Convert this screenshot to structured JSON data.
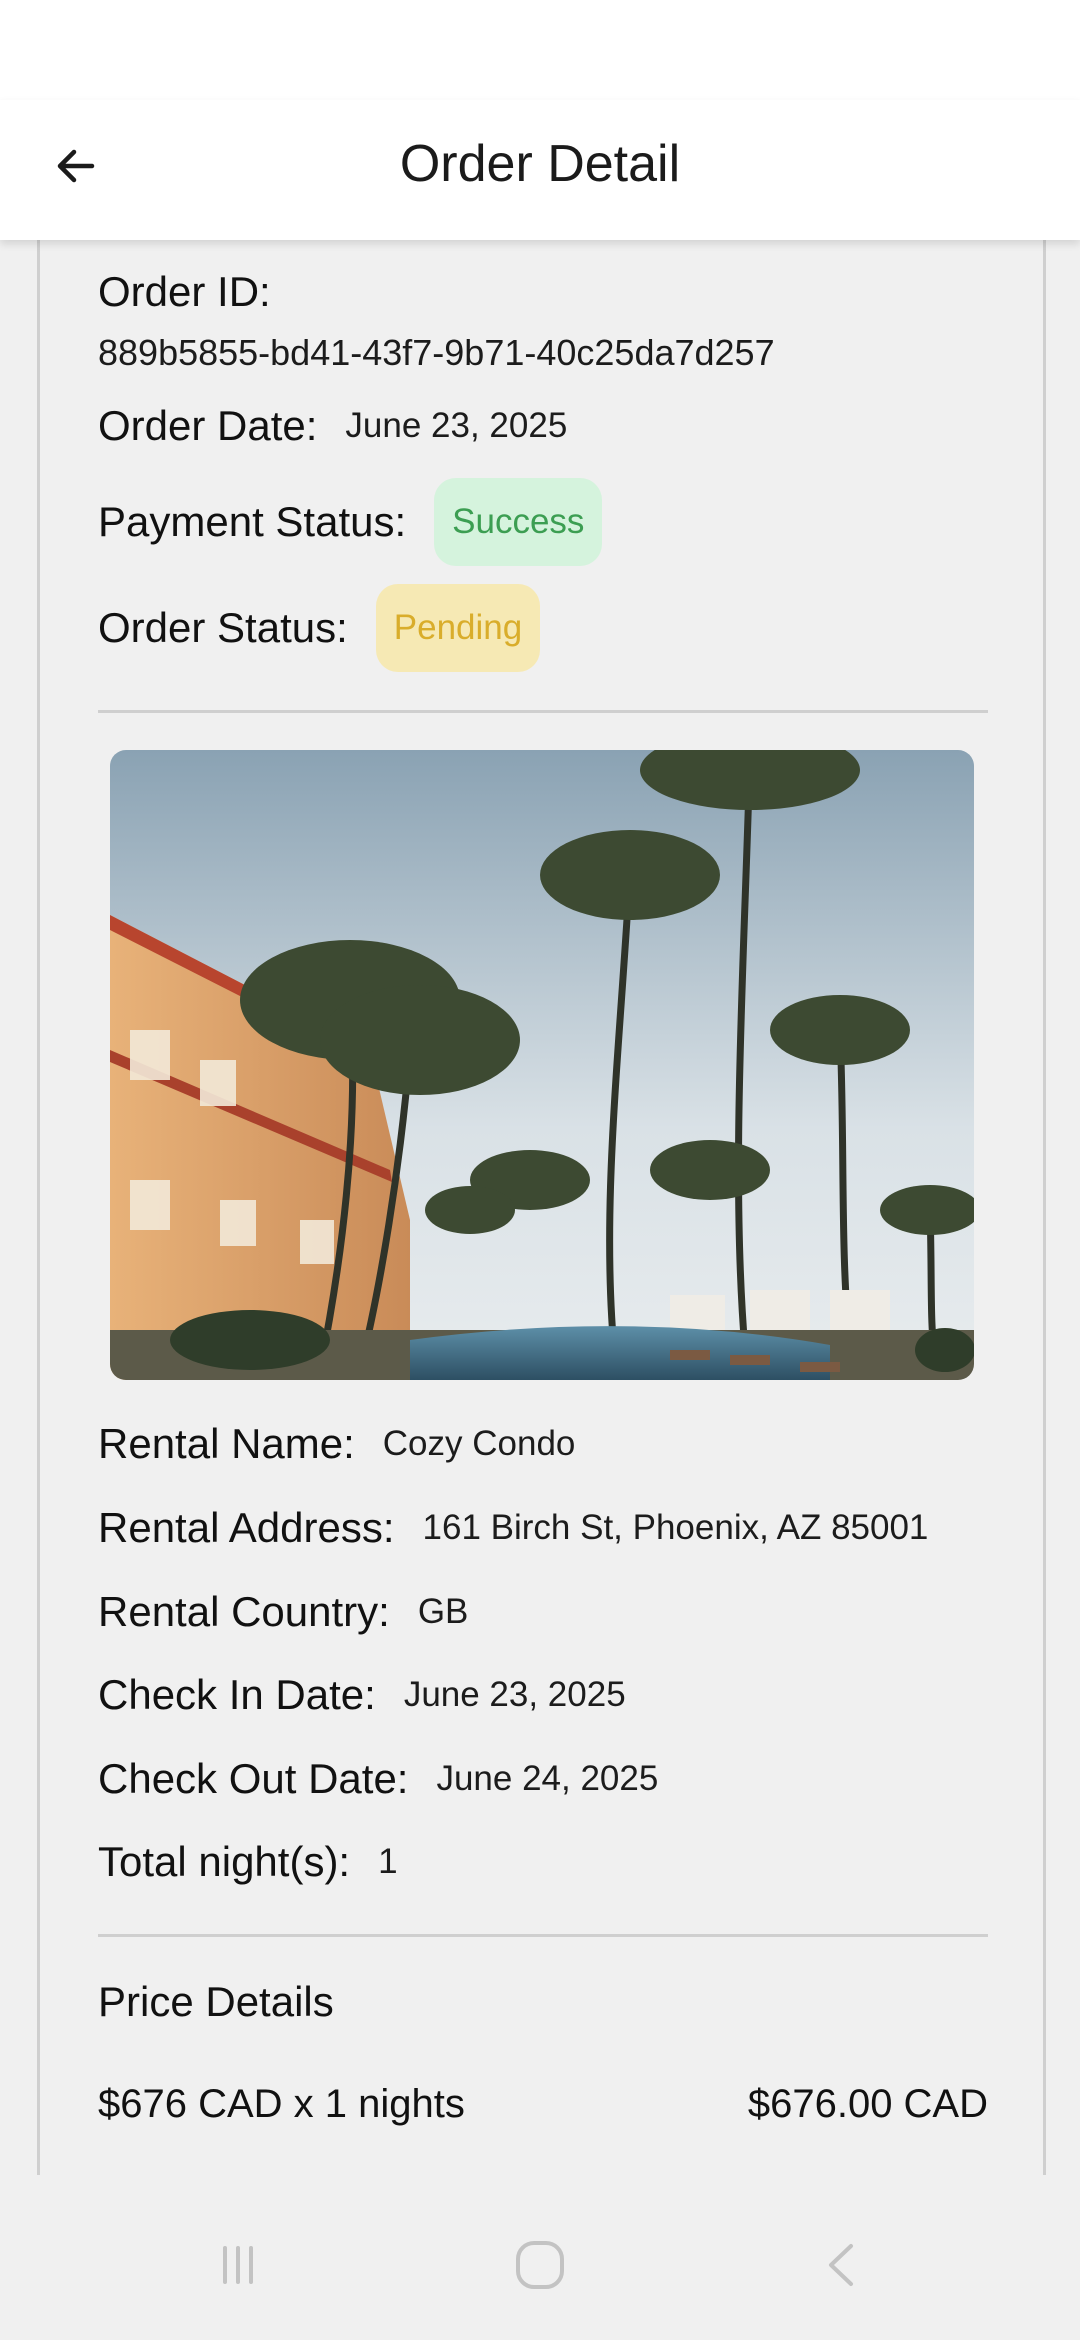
{
  "header": {
    "title": "Order Detail"
  },
  "order": {
    "id_label": "Order ID:",
    "id_value": "889b5855-bd41-43f7-9b71-40c25da7d257",
    "date_label": "Order Date:",
    "date_value": "June 23, 2025",
    "payment_status_label": "Payment Status:",
    "payment_status_value": "Success",
    "order_status_label": "Order Status:",
    "order_status_value": "Pending"
  },
  "rental": {
    "name_label": "Rental Name:",
    "name_value": "Cozy Condo",
    "address_label": "Rental Address:",
    "address_value": "161 Birch St, Phoenix, AZ 85001",
    "country_label": "Rental Country:",
    "country_value": "GB",
    "checkin_label": "Check In Date:",
    "checkin_value": "June 23, 2025",
    "checkout_label": "Check Out Date:",
    "checkout_value": "June 24, 2025",
    "nights_label": "Total night(s):",
    "nights_value": "1"
  },
  "price": {
    "title": "Price Details",
    "lines": [
      {
        "label": "$676 CAD x 1 nights",
        "amount": "$676.00 CAD"
      }
    ]
  },
  "icons": {
    "back": "arrow-left-icon",
    "nav_recent": "recent-apps-icon",
    "nav_home": "home-icon",
    "nav_back": "back-chevron-icon"
  },
  "colors": {
    "success_bg": "#d5f3dd",
    "success_text": "#3c9e52",
    "pending_bg": "#f6e9b4",
    "pending_text": "#d9ad2b"
  }
}
